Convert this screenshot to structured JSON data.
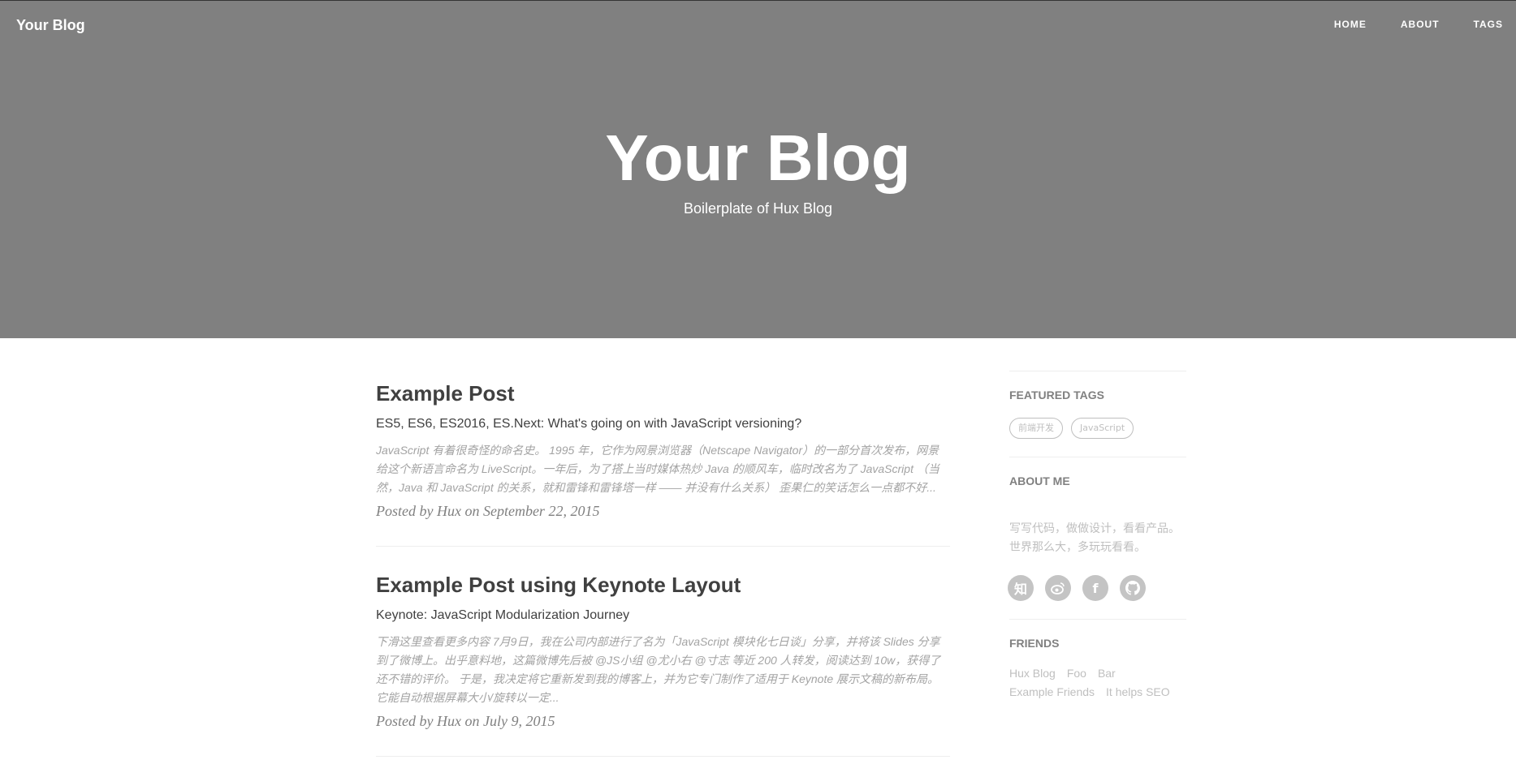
{
  "header": {
    "brand": "Your Blog",
    "nav": [
      {
        "label": "HOME"
      },
      {
        "label": "ABOUT"
      },
      {
        "label": "TAGS"
      }
    ],
    "title": "Your Blog",
    "subtitle": "Boilerplate of Hux Blog"
  },
  "posts": [
    {
      "title": "Example Post",
      "subtitle": "ES5, ES6, ES2016, ES.Next: What's going on with JavaScript versioning?",
      "excerpt": "JavaScript 有着很奇怪的命名史。 1995 年，它作为网景浏览器（Netscape Navigator）的一部分首次发布，网景给这个新语言命名为 LiveScript。一年后，为了搭上当时媒体热炒 Java 的顺风车，临时改名为了 JavaScript （当然，Java 和 JavaScript 的关系，就和雷锋和雷锋塔一样 —— 并没有什么关系） 歪果仁的笑话怎么一点都不好...",
      "meta": "Posted by Hux on September 22, 2015"
    },
    {
      "title": "Example Post using Keynote Layout",
      "subtitle": "Keynote: JavaScript Modularization Journey",
      "excerpt": "下滑这里查看更多内容 7月9日，我在公司内部进行了名为「JavaScript 模块化七日谈」分享，并将该 Slides 分享到了微博上。出乎意料地，这篇微博先后被 @JS小组 @尤小右 @寸志 等近 200 人转发，阅读达到 10w，获得了还不错的评价。 于是，我决定将它重新发到我的博客上，并为它专门制作了适用于 Keynote 展示文稿的新布局。它能自动根据屏幕大小/旋转以一定...",
      "meta": "Posted by Hux on July 9, 2015"
    }
  ],
  "sidebar": {
    "featured_tags_heading": "FEATURED TAGS",
    "tags": [
      {
        "label": "前端开发"
      },
      {
        "label": "JavaScript"
      }
    ],
    "about_heading": "ABOUT ME",
    "about_text": "写写代码，做做设计，看看产品。世界那么大，多玩玩看看。",
    "social": [
      {
        "icon": "zhihu-icon",
        "glyph": "知"
      },
      {
        "icon": "weibo-icon",
        "glyph": ""
      },
      {
        "icon": "facebook-icon",
        "glyph": "f"
      },
      {
        "icon": "github-icon",
        "glyph": ""
      }
    ],
    "friends_heading": "FRIENDS",
    "friends": [
      {
        "label": "Hux Blog"
      },
      {
        "label": "Foo"
      },
      {
        "label": "Bar"
      },
      {
        "label": "Example Friends"
      },
      {
        "label": "It helps SEO"
      }
    ]
  },
  "colors": {
    "hero_bg": "#808080",
    "text": "#404040",
    "muted": "#a3a3a3",
    "light": "#bfbfbf"
  }
}
